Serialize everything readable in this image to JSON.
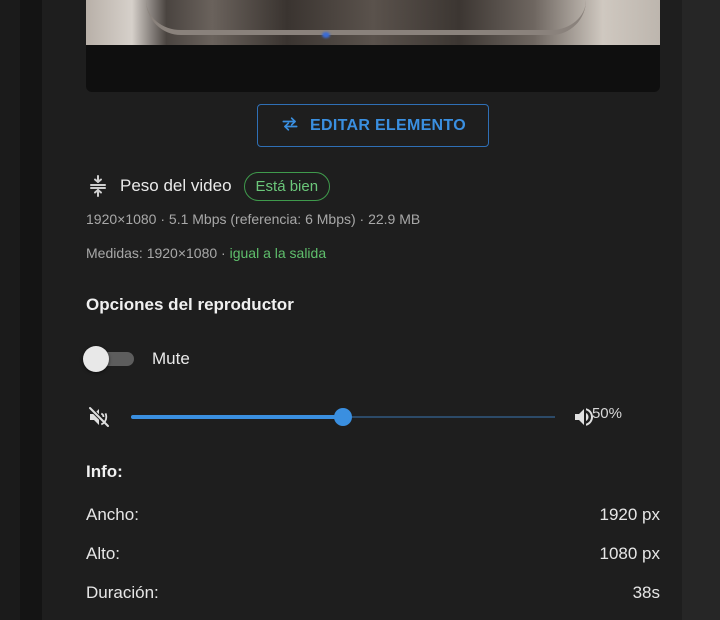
{
  "edit_button": {
    "label": "EDITAR ELEMENTO"
  },
  "weight": {
    "title": "Peso del video",
    "status_badge": "Está bien",
    "details": "1920×1080 · 5.1 Mbps (referencia: 6 Mbps) · 22.9 MB",
    "measures_prefix": "Medidas: 1920×1080 · ",
    "measures_status": "igual a la salida"
  },
  "player_options": {
    "title": "Opciones del reproductor",
    "mute_label": "Mute",
    "mute_on": false,
    "volume_fraction": 0.5,
    "volume_label": "50%"
  },
  "info": {
    "title": "Info:",
    "rows": [
      {
        "label": "Ancho:",
        "value": "1920 px"
      },
      {
        "label": "Alto:",
        "value": "1080 px"
      },
      {
        "label": "Duración:",
        "value": "38s"
      }
    ]
  },
  "colors": {
    "accent": "#3a8fe0",
    "ok_green": "#5fbf6c",
    "background": "#1e1e1e"
  },
  "icons": {
    "edit": "swap-arrows-icon",
    "weight": "compress-vertical-icon",
    "mute": "volume-off-icon",
    "volume": "volume-up-icon"
  }
}
